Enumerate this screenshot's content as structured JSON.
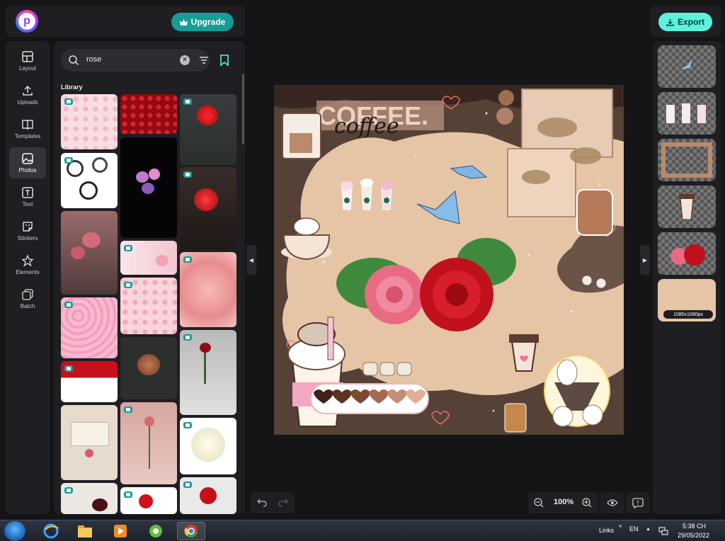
{
  "header": {
    "upgrade_label": "Upgrade",
    "export_label": "Export"
  },
  "rail": {
    "items": [
      {
        "label": "Layout"
      },
      {
        "label": "Uploads"
      },
      {
        "label": "Templates"
      },
      {
        "label": "Photos"
      },
      {
        "label": "Text"
      },
      {
        "label": "Stickers"
      },
      {
        "label": "Elements"
      },
      {
        "label": "Batch"
      }
    ],
    "active": "Photos"
  },
  "panel": {
    "search_value": "rose",
    "library_label": "Library"
  },
  "canvas": {
    "title_text": "COFFEE.",
    "script_text": "coffee"
  },
  "zoom": {
    "level": "100%"
  },
  "layers": {
    "size_label": "1080x1080px"
  },
  "taskbar": {
    "links_label": "Links",
    "lang": "EN",
    "time": "5:38 CH",
    "date": "29/05/2022"
  },
  "colors": {
    "accent": "#169d96",
    "export": "#5ef1de",
    "canvas_bg": "#e6c4a6"
  }
}
